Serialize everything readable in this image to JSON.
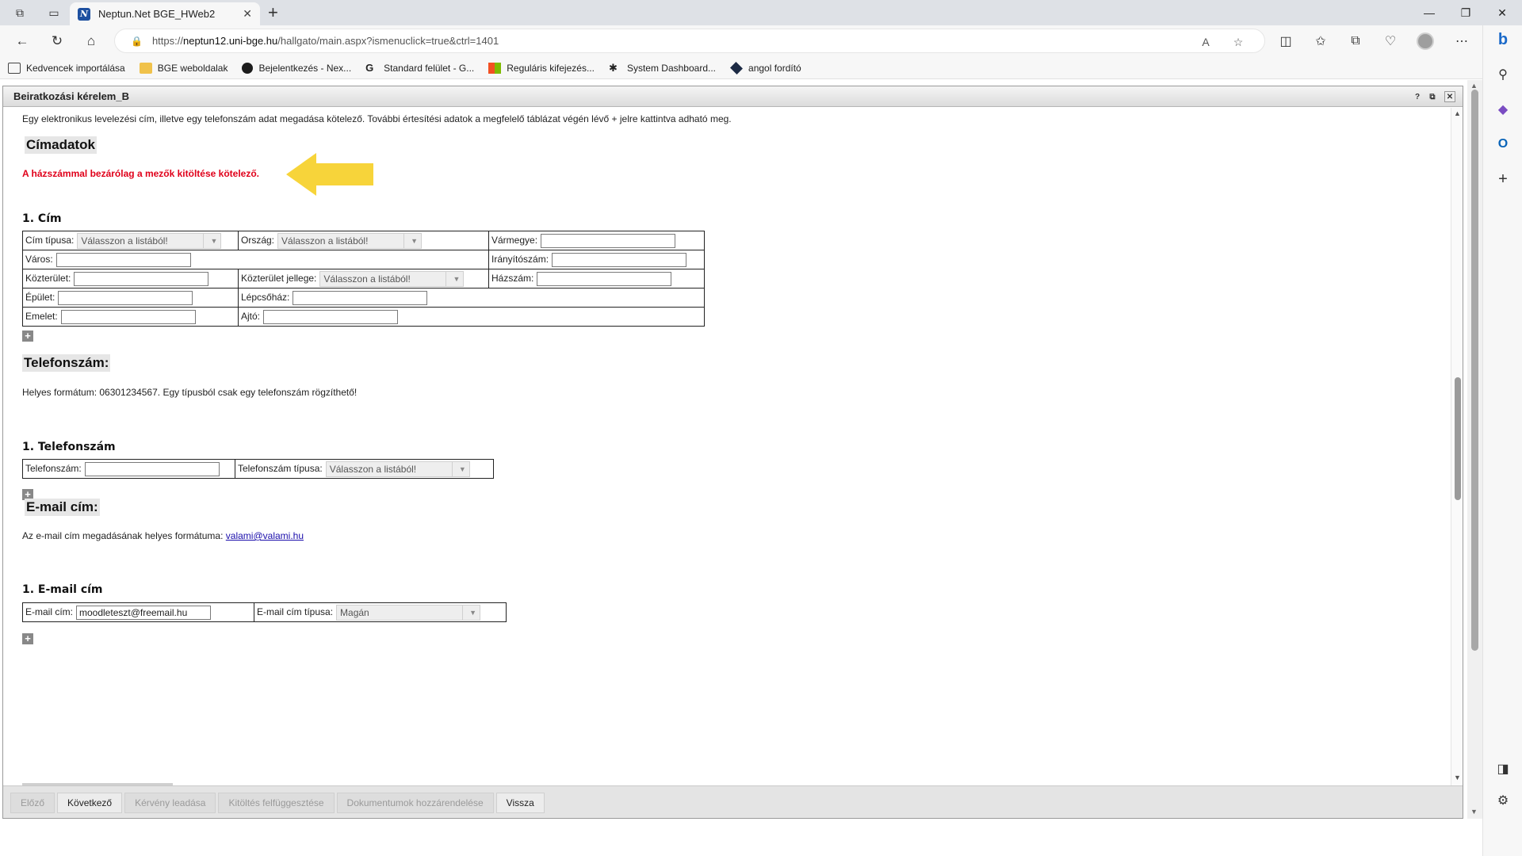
{
  "browser": {
    "tab_title": "Neptun.Net BGE_HWeb2",
    "url_prefix": "https://",
    "url_host": "neptun12.uni-bge.hu",
    "url_path": "/hallgato/main.aspx?ismenuclick=true&ctrl=1401",
    "bookmarks": [
      {
        "label": "Kedvencek importálása",
        "icon": "import-icon"
      },
      {
        "label": "BGE weboldalak",
        "icon": "folder-icon"
      },
      {
        "label": "Bejelentkezés - Nex...",
        "icon": "nexus-icon"
      },
      {
        "label": "Standard felület - G...",
        "icon": "g-icon"
      },
      {
        "label": "Reguláris kifejezés...",
        "icon": "windows-icon"
      },
      {
        "label": "System Dashboard...",
        "icon": "dashboard-icon"
      },
      {
        "label": "angol fordító",
        "icon": "translate-icon"
      }
    ]
  },
  "dialog": {
    "title": "Beiratkozási kérelem_B",
    "help_label": "?",
    "close_label": "✕",
    "intro_line": "Egy elektronikus levelezési cím, illetve egy telefonszám adat megadása kötelező. További értesítési adatok a megfelelő táblázat végén lévő + jelre kattintva adható meg.",
    "address": {
      "heading": "Címadatok",
      "warning": "A házszámmal bezárólag a mezők kitöltése kötelező.",
      "subheading": "1. Cím",
      "labels": {
        "cim_tipusa": "Cím típusa:",
        "orszag": "Ország:",
        "varmegye": "Vármegye:",
        "varos": "Város:",
        "iranyitoszam": "Irányítószám:",
        "kozterulet": "Közterület:",
        "kozterulet_jellege": "Közterület jellege:",
        "hazszam": "Házszám:",
        "epulet": "Épület:",
        "lepcsohaz": "Lépcsőház:",
        "emelet": "Emelet:",
        "ajto": "Ajtó:"
      },
      "select_placeholder": "Válasszon a listából!"
    },
    "phone": {
      "heading": "Telefonszám:",
      "note": "Helyes formátum: 06301234567. Egy típusból csak egy telefonszám rögzíthető!",
      "subheading": "1. Telefonszám",
      "label_number": "Telefonszám:",
      "label_type": "Telefonszám típusa:",
      "type_value": "Válasszon a listából!"
    },
    "email": {
      "heading": "E-mail cím:",
      "note_prefix": "Az e-mail cím megadásának helyes formátuma: ",
      "note_link": "valami@valami.hu",
      "subheading": "1. E-mail cím",
      "label_address": "E-mail cím:",
      "address_value": "moodleteszt@freemail.hu",
      "label_type": "E-mail cím típusa:",
      "type_value": "Magán"
    },
    "footer_buttons": [
      {
        "label": "Előző",
        "enabled": false
      },
      {
        "label": "Következő",
        "enabled": true
      },
      {
        "label": "Kérvény leadása",
        "enabled": false
      },
      {
        "label": "Kitöltés felfüggesztése",
        "enabled": false
      },
      {
        "label": "Dokumentumok hozzárendelése",
        "enabled": false
      },
      {
        "label": "Vissza",
        "enabled": true
      }
    ]
  },
  "colors": {
    "warning_text": "#e0001a",
    "annotation_arrow": "#f7d43a",
    "link": "#1a0dab"
  }
}
